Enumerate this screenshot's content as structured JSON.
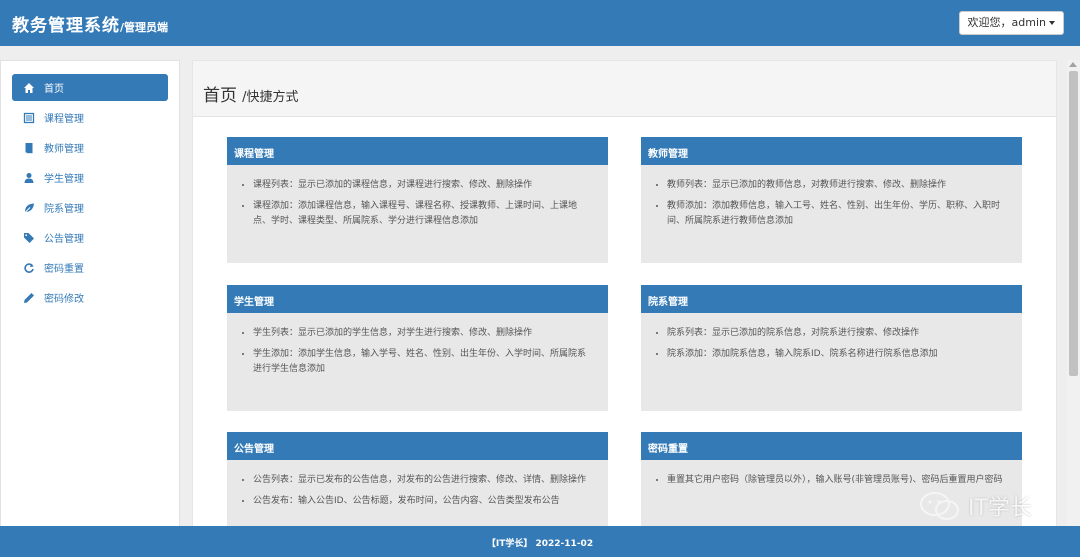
{
  "header": {
    "title": "教务管理系统",
    "subtitle": "/管理员端",
    "user_menu": "欢迎您，admin"
  },
  "sidebar": {
    "items": [
      {
        "label": "首页",
        "icon": "home-icon",
        "active": true
      },
      {
        "label": "课程管理",
        "icon": "list-icon"
      },
      {
        "label": "教师管理",
        "icon": "book-icon"
      },
      {
        "label": "学生管理",
        "icon": "user-icon"
      },
      {
        "label": "院系管理",
        "icon": "leaf-icon"
      },
      {
        "label": "公告管理",
        "icon": "tags-icon"
      },
      {
        "label": "密码重置",
        "icon": "refresh-icon"
      },
      {
        "label": "密码修改",
        "icon": "pencil-icon"
      }
    ]
  },
  "main": {
    "title": "首页",
    "subtitle": "/快捷方式",
    "panels": [
      {
        "title": "课程管理",
        "items": [
          "课程列表：显示已添加的课程信息，对课程进行搜索、修改、删除操作",
          "课程添加：添加课程信息，输入课程号、课程名称、授课教师、上课时间、上课地点、学时、课程类型、所属院系、学分进行课程信息添加"
        ]
      },
      {
        "title": "教师管理",
        "items": [
          "教师列表：显示已添加的教师信息，对教师进行搜索、修改、删除操作",
          "教师添加：添加教师信息，输入工号、姓名、性别、出生年份、学历、职称、入职时间、所属院系进行教师信息添加"
        ]
      },
      {
        "title": "学生管理",
        "items": [
          "学生列表：显示已添加的学生信息，对学生进行搜索、修改、删除操作",
          "学生添加：添加学生信息，输入学号、姓名、性别、出生年份、入学时间、所属院系进行学生信息添加"
        ]
      },
      {
        "title": "院系管理",
        "items": [
          "院系列表：显示已添加的院系信息，对院系进行搜索、修改操作",
          "院系添加：添加院系信息，输入院系ID、院系名称进行院系信息添加"
        ]
      },
      {
        "title": "公告管理",
        "items": [
          "公告列表：显示已发布的公告信息，对发布的公告进行搜索、修改、详情、删除操作",
          "公告发布：输入公告ID、公告标题，发布时间，公告内容、公告类型发布公告"
        ]
      },
      {
        "title": "密码重置",
        "items": [
          "重置其它用户密码（除管理员以外），输入账号(非管理员账号)、密码后重置用户密码"
        ]
      }
    ]
  },
  "footer": {
    "text": "【IT学长】 2022-11-02"
  },
  "watermark": {
    "text": "IT学长"
  },
  "colors": {
    "primary": "#337ab7",
    "panel_bg": "#e8e8e8"
  }
}
